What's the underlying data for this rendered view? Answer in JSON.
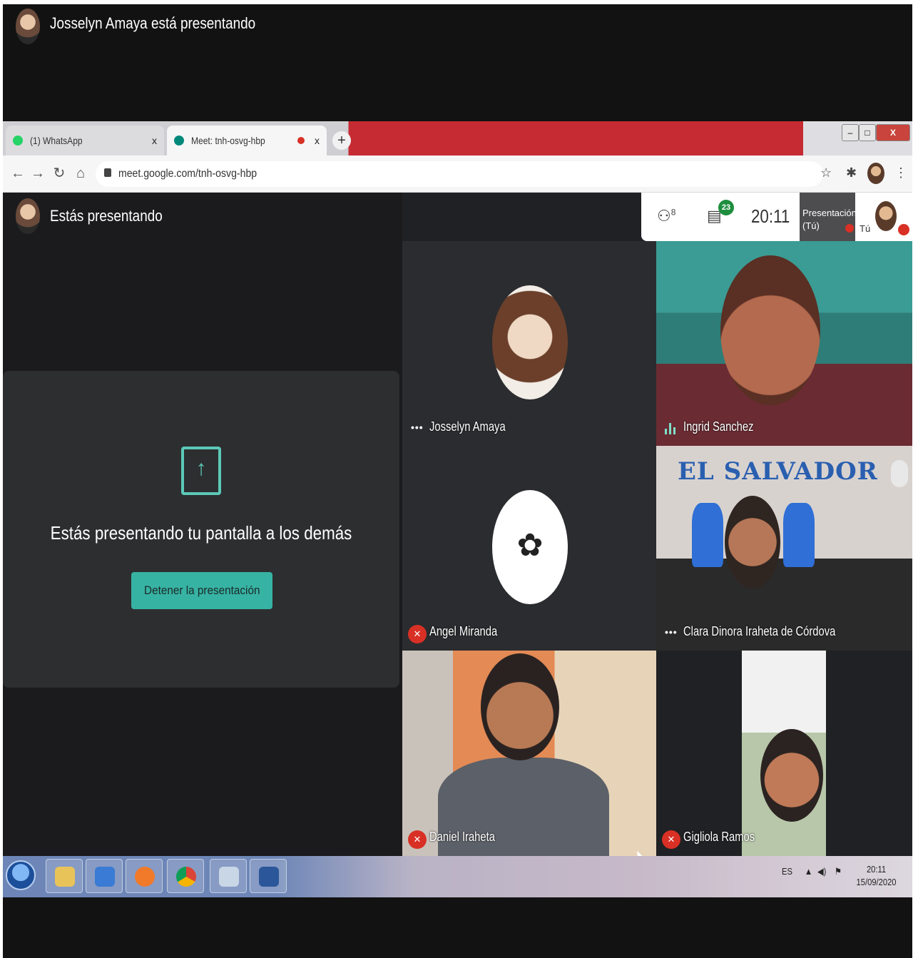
{
  "banner": {
    "presenter_text": "Josselyn Amaya está presentando"
  },
  "browser": {
    "tabs": [
      {
        "label": "(1) WhatsApp",
        "close": "x"
      },
      {
        "label": "Meet: tnh-osvg-hbp",
        "close": "x"
      }
    ],
    "new_tab": "+",
    "url": "meet.google.com/tnh-osvg-hbp",
    "window_controls": {
      "minimize": "–",
      "maximize": "□",
      "close": "X"
    }
  },
  "meet": {
    "presenting_label": "Estás presentando",
    "present_card": {
      "message": "Estás presentando tu pantalla a los demás",
      "stop_button": "Detener la presentación"
    },
    "topbar": {
      "people_count": "8",
      "chat_badge": "23",
      "clock": "20:11",
      "self_tile": {
        "line1": "Presentación",
        "line2": "(Tú)",
        "you": "Tú"
      }
    },
    "participants": [
      {
        "name": "Josselyn Amaya",
        "status": "more"
      },
      {
        "name": "Ingrid Sanchez",
        "status": "speaking"
      },
      {
        "name": "Angel Miranda",
        "status": "muted"
      },
      {
        "name": "Clara Dinora Iraheta de Córdova",
        "status": "more"
      },
      {
        "name": "Daniel Iraheta",
        "status": "muted"
      },
      {
        "name": "Gigliola Ramos",
        "status": "muted"
      }
    ],
    "clara_banner_text": "EL SALVADOR"
  },
  "taskbar": {
    "language": "ES",
    "time": "20:11",
    "date": "15/09/2020"
  }
}
